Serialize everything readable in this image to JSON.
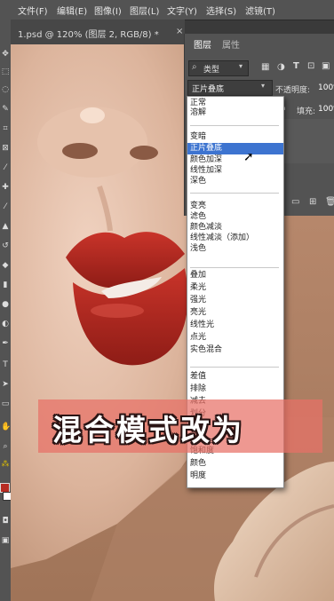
{
  "menubar": {
    "items": [
      "文件(F)",
      "编辑(E)",
      "图像(I)",
      "图层(L)",
      "文字(Y)",
      "选择(S)",
      "滤镜(T)"
    ]
  },
  "document": {
    "tab_label": "1.psd @ 120% (图层 2, RGB/8) *",
    "close": "×"
  },
  "layers_panel": {
    "tabs": [
      "图层",
      "属性"
    ],
    "filter_label": "类型",
    "blend_mode": "正片叠底",
    "opacity_label": "不透明度:",
    "opacity_value": "100%",
    "fill_label": "填充:",
    "fill_value": "100%"
  },
  "blend_menu": {
    "groups": [
      [
        "正常",
        "溶解"
      ],
      [
        "变暗",
        "正片叠底",
        "颜色加深",
        "线性加深",
        "深色"
      ],
      [
        "变亮",
        "滤色",
        "颜色减淡",
        "线性减淡（添加）",
        "浅色"
      ],
      [
        "叠加",
        "柔光",
        "强光",
        "亮光",
        "线性光",
        "点光",
        "实色混合"
      ],
      [
        "差值",
        "排除",
        "减去",
        "划分"
      ],
      [
        "色相",
        "饱和度",
        "颜色",
        "明度"
      ]
    ],
    "selected": "正片叠底"
  },
  "caption": {
    "text": "混合模式改为"
  },
  "colors": {
    "accent_selected": "#3d74d0",
    "banner": "#e87066",
    "lips": "#b0281f",
    "skin": "#d8b096"
  }
}
